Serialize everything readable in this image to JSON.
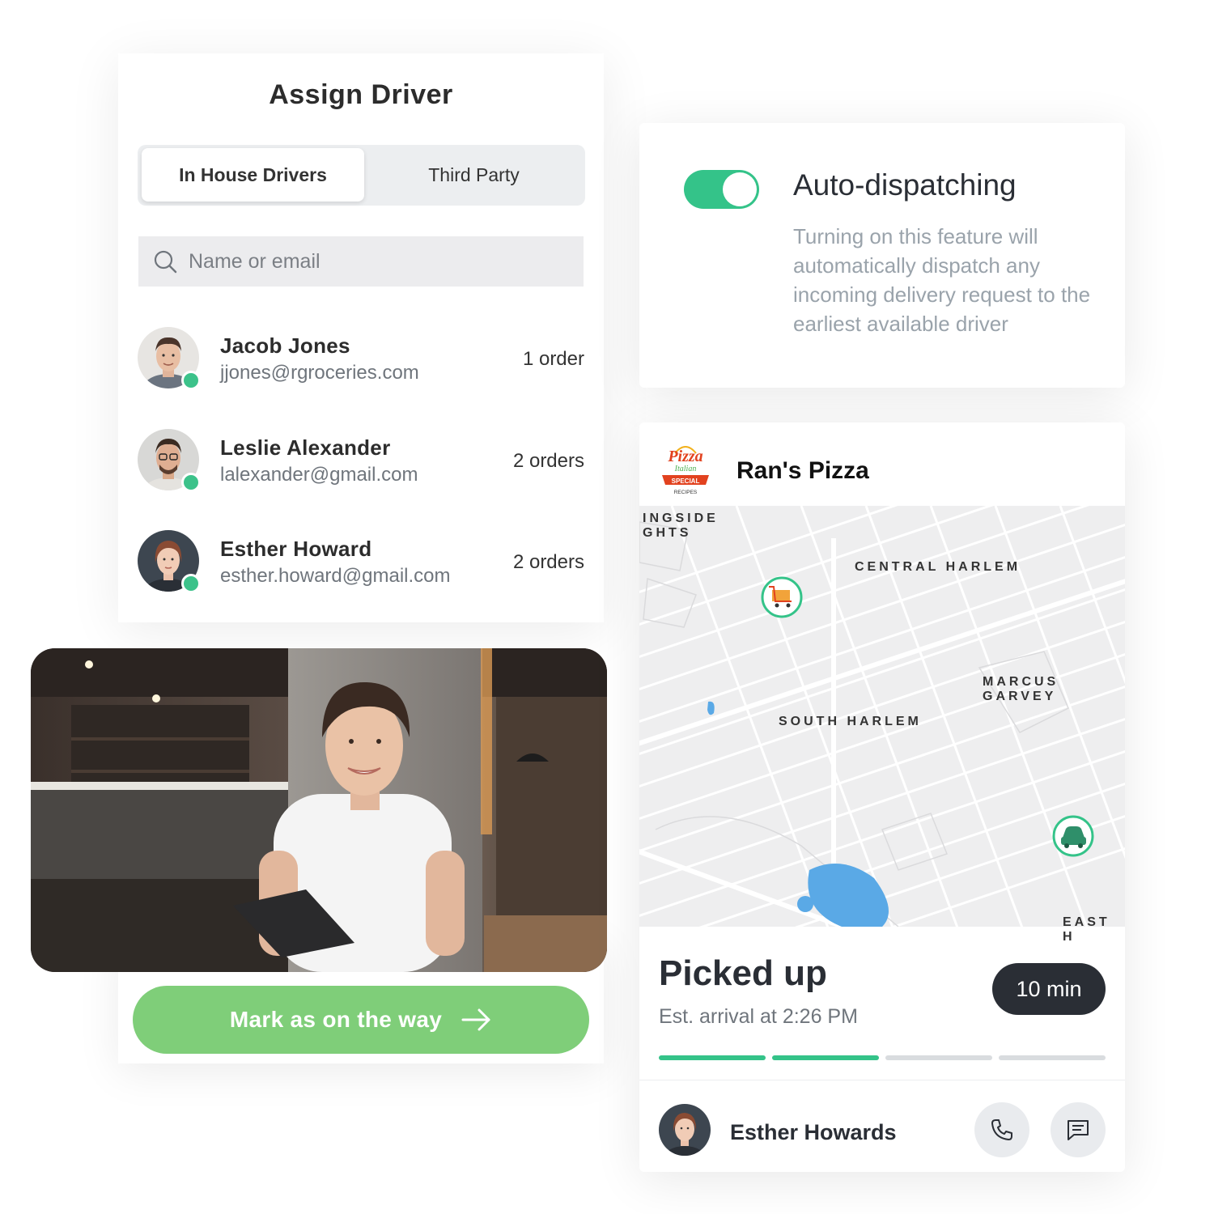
{
  "assign": {
    "title": "Assign Driver",
    "tabs": {
      "in_house": "In House Drivers",
      "third_party": "Third Party"
    },
    "search_placeholder": "Name or email",
    "drivers": [
      {
        "name": "Jacob Jones",
        "email": "jjones@rgroceries.com",
        "orders": "1 order"
      },
      {
        "name": "Leslie Alexander",
        "email": "lalexander@gmail.com",
        "orders": "2 orders"
      },
      {
        "name": "Esther Howard",
        "email": "esther.howard@gmail.com",
        "orders": "2 orders"
      }
    ]
  },
  "cta": {
    "label": "Mark as on the way"
  },
  "auto_dispatch": {
    "title": "Auto-dispatching",
    "description": "Turning on this feature will automatically dispatch any incoming delivery request to the earliest available driver",
    "enabled": true
  },
  "delivery": {
    "logo": {
      "word": "Pizza",
      "sub": "Italian",
      "badge": "SPECIAL",
      "foot": "RECIPES"
    },
    "store_name": "Ran's Pizza",
    "map_labels": {
      "central_harlem": "CENTRAL HARLEM",
      "south_harlem": "SOUTH HARLEM",
      "marcus_garvey_1": "MARCUS",
      "marcus_garvey_2": "GARVEY",
      "heights_1": "INGSIDE",
      "heights_2": "GHTS",
      "east_harlem": "EAST H"
    },
    "status": "Picked up",
    "eta": "Est. arrival at 2:26 PM",
    "time": "10 min",
    "progress_steps_done": 2,
    "progress_steps_total": 4,
    "courier_name": "Esther Howards"
  },
  "colors": {
    "accent_green": "#34c389",
    "cta_green": "#7fce79",
    "dark": "#2a2e35",
    "progress_inactive": "#d9dcdf"
  }
}
